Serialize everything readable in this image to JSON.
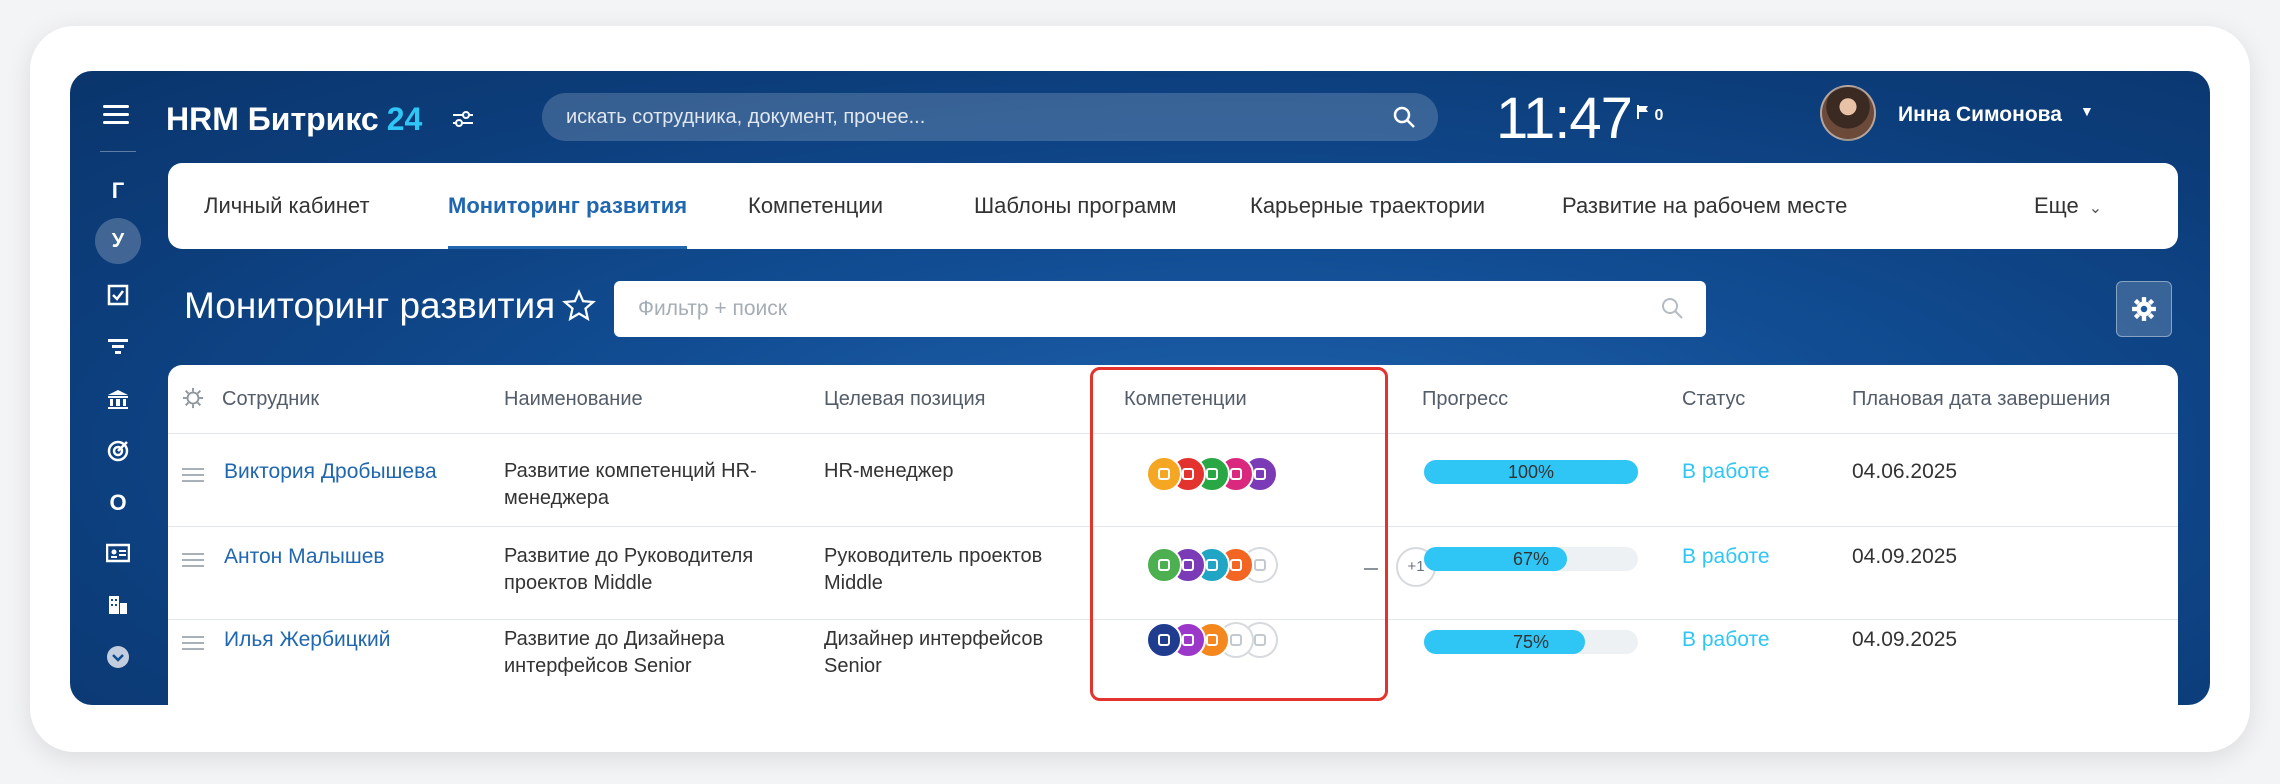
{
  "app": {
    "logo": "HRM Битрикс",
    "logo_num": "24",
    "search_placeholder": "искать сотрудника, документ, прочее...",
    "clock": "11:47",
    "flag_count": "0",
    "user_name": "Инна Симонова"
  },
  "rail": {
    "items": [
      {
        "label": "Г"
      },
      {
        "label": "У"
      },
      {
        "label": "О"
      }
    ]
  },
  "tabs": [
    {
      "label": "Личный кабинет"
    },
    {
      "label": "Мониторинг развития"
    },
    {
      "label": "Компетенции"
    },
    {
      "label": "Шаблоны программ"
    },
    {
      "label": "Карьерные траектории"
    },
    {
      "label": "Развитие на рабочем месте"
    },
    {
      "label": "Еще"
    }
  ],
  "page": {
    "title": "Мониторинг развития",
    "filter_placeholder": "Фильтр + поиск"
  },
  "table": {
    "headers": [
      "Сотрудник",
      "Наименование",
      "Целевая позиция",
      "Компетенции",
      "Прогресс",
      "Статус",
      "Плановая дата завершения"
    ],
    "rows": [
      {
        "employee": "Виктория Дробышева",
        "name_line1": "Развитие компетенций HR-",
        "name_line2": "менеджера",
        "position_line1": "HR-менеджер",
        "position_line2": "",
        "progress": 100,
        "progress_label": "100%",
        "status": "В работе",
        "date": "04.06.2025",
        "competencies": [
          "#f5a623",
          "#e2332f",
          "#2aa745",
          "#d9287d",
          "#7b3bb6"
        ]
      },
      {
        "employee": "Антон Малышев",
        "name_line1": "Развитие до Руководителя",
        "name_line2": "проектов Middle",
        "position_line1": "Руководитель проектов",
        "position_line2": "Middle",
        "progress": 67,
        "progress_label": "67%",
        "status": "В работе",
        "date": "04.09.2025",
        "competencies": [
          "#4caf50",
          "#7b3bb6",
          "#20a6c4",
          "#f26522",
          "grey"
        ],
        "extra": "+1"
      },
      {
        "employee": "Илья Жербицкий",
        "name_line1": "Развитие до Дизайнера",
        "name_line2": "интерфейсов Senior",
        "position_line1": "Дизайнер интерфейсов",
        "position_line2": "Senior",
        "progress": 75,
        "progress_label": "75%",
        "status": "В работе",
        "date": "04.09.2025",
        "competencies": [
          "#1f3c8f",
          "#9b38c9",
          "#f5871f",
          "grey",
          "grey"
        ]
      }
    ]
  }
}
